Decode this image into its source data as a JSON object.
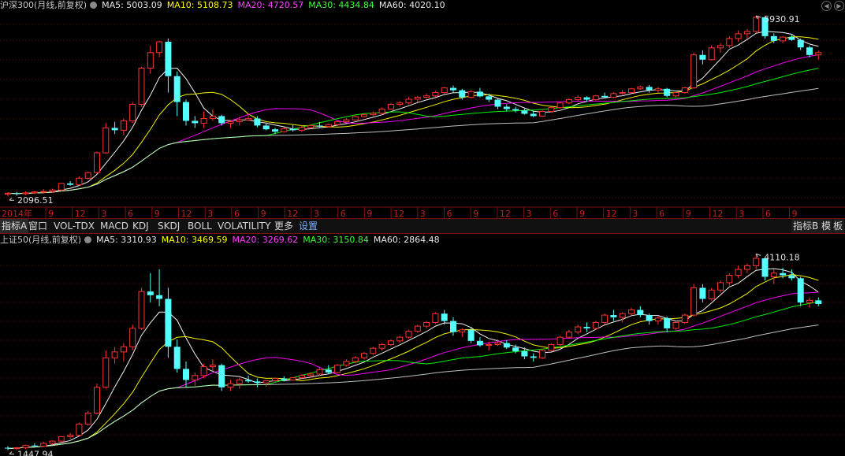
{
  "panels": [
    {
      "name": "沪深300(月线,前复权)",
      "ma": [
        {
          "label": "MA5: 5003.09",
          "color": "#ffffff"
        },
        {
          "label": "MA10: 5108.73",
          "color": "#ffff00"
        },
        {
          "label": "MA20: 4720.57",
          "color": "#ff00ff"
        },
        {
          "label": "MA30: 4434.84",
          "color": "#00ff00"
        },
        {
          "label": "MA60: 4020.10",
          "color": "#ffffff"
        }
      ],
      "high_label": "5930.91",
      "low_label": "2096.51"
    },
    {
      "name": "上证50(月线,前复权)",
      "ma": [
        {
          "label": "MA5: 3310.93",
          "color": "#ffffff"
        },
        {
          "label": "MA10: 3469.59",
          "color": "#ffff00"
        },
        {
          "label": "MA20: 3269.62",
          "color": "#ff00ff"
        },
        {
          "label": "MA30: 3150.84",
          "color": "#00ff00"
        },
        {
          "label": "MA60: 2864.48",
          "color": "#ffffff"
        }
      ],
      "high_label": "4110.18",
      "low_label": "1447.94"
    }
  ],
  "time_axis": {
    "labels": [
      "2014年",
      "9",
      "12",
      "3",
      "6",
      "9",
      "12",
      "3",
      "6",
      "9",
      "12",
      "3",
      "6",
      "9",
      "12",
      "3",
      "6",
      "9",
      "12",
      "3",
      "6",
      "9",
      "12",
      "3",
      "6",
      "9",
      "12",
      "3",
      "6",
      "9"
    ]
  },
  "toolbar": {
    "tabs": [
      "指标A",
      "窗口",
      "VOL-TDX",
      "MACD",
      "KDJ",
      "SKDJ",
      "BOLL",
      "VOLATILITY",
      "更多",
      "设置"
    ],
    "right_tabs": [
      "指标B",
      "模",
      "板"
    ]
  },
  "chart_data": [
    {
      "type": "candlestick",
      "title": "沪深300(月线,前复权)",
      "x_start": "2014-01",
      "period": "monthly",
      "ylim": [
        2000,
        6000
      ],
      "ohlc": [
        [
          2140,
          2180,
          2096.51,
          2160
        ],
        [
          2160,
          2190,
          2110,
          2150
        ],
        [
          2150,
          2200,
          2120,
          2170
        ],
        [
          2170,
          2210,
          2140,
          2190
        ],
        [
          2190,
          2250,
          2160,
          2200
        ],
        [
          2200,
          2260,
          2170,
          2230
        ],
        [
          2230,
          2380,
          2200,
          2370
        ],
        [
          2370,
          2420,
          2320,
          2340
        ],
        [
          2340,
          2520,
          2330,
          2480
        ],
        [
          2480,
          2620,
          2450,
          2600
        ],
        [
          2600,
          3050,
          2580,
          3020
        ],
        [
          3020,
          3650,
          3000,
          3550
        ],
        [
          3550,
          3680,
          3420,
          3500
        ],
        [
          3500,
          3750,
          3400,
          3700
        ],
        [
          3700,
          4100,
          3650,
          4050
        ],
        [
          4050,
          4850,
          4000,
          4820
        ],
        [
          4820,
          5300,
          4700,
          5150
        ],
        [
          5150,
          5400,
          5050,
          5380
        ],
        [
          5380,
          5450,
          4300,
          4650
        ],
        [
          4650,
          4750,
          3800,
          4100
        ],
        [
          4100,
          4150,
          3600,
          3700
        ],
        [
          3700,
          3800,
          3550,
          3650
        ],
        [
          3650,
          3900,
          3550,
          3750
        ],
        [
          3750,
          3950,
          3700,
          3800
        ],
        [
          3800,
          3830,
          3600,
          3650
        ],
        [
          3650,
          3700,
          3550,
          3680
        ],
        [
          3680,
          3780,
          3600,
          3720
        ],
        [
          3720,
          3820,
          3700,
          3750
        ],
        [
          3750,
          3800,
          3560,
          3600
        ],
        [
          3600,
          3640,
          3500,
          3520
        ],
        [
          3520,
          3550,
          3420,
          3470
        ],
        [
          3470,
          3560,
          3450,
          3530
        ],
        [
          3530,
          3610,
          3470,
          3500
        ],
        [
          3500,
          3600,
          3460,
          3560
        ],
        [
          3560,
          3620,
          3540,
          3600
        ],
        [
          3600,
          3680,
          3550,
          3580
        ],
        [
          3580,
          3640,
          3560,
          3620
        ],
        [
          3620,
          3700,
          3590,
          3680
        ],
        [
          3680,
          3760,
          3650,
          3720
        ],
        [
          3720,
          3810,
          3700,
          3790
        ],
        [
          3790,
          3850,
          3770,
          3830
        ],
        [
          3830,
          3900,
          3800,
          3860
        ],
        [
          3860,
          3980,
          3840,
          3950
        ],
        [
          3950,
          4080,
          3930,
          4050
        ],
        [
          4050,
          4120,
          4000,
          4080
        ],
        [
          4080,
          4200,
          4050,
          4160
        ],
        [
          4160,
          4230,
          4100,
          4200
        ],
        [
          4200,
          4280,
          4180,
          4230
        ],
        [
          4230,
          4340,
          4200,
          4300
        ],
        [
          4300,
          4420,
          4280,
          4400
        ],
        [
          4400,
          4450,
          4300,
          4350
        ],
        [
          4350,
          4380,
          4150,
          4200
        ],
        [
          4200,
          4350,
          4180,
          4320
        ],
        [
          4320,
          4400,
          4200,
          4220
        ],
        [
          4220,
          4280,
          4100,
          4150
        ],
        [
          4150,
          4180,
          3950,
          4000
        ],
        [
          4000,
          4050,
          3900,
          3950
        ],
        [
          3950,
          4000,
          3880,
          3920
        ],
        [
          3920,
          3960,
          3830,
          3850
        ],
        [
          3850,
          3900,
          3780,
          3800
        ],
        [
          3800,
          3950,
          3780,
          3900
        ],
        [
          3900,
          4000,
          3880,
          3980
        ],
        [
          3980,
          4100,
          3960,
          4080
        ],
        [
          4080,
          4180,
          4050,
          4150
        ],
        [
          4150,
          4250,
          4120,
          4200
        ],
        [
          4200,
          4220,
          4100,
          4150
        ],
        [
          4150,
          4250,
          4130,
          4230
        ],
        [
          4230,
          4300,
          4180,
          4200
        ],
        [
          4200,
          4310,
          4180,
          4280
        ],
        [
          4280,
          4360,
          4260,
          4300
        ],
        [
          4300,
          4400,
          4280,
          4380
        ],
        [
          4380,
          4450,
          4360,
          4420
        ],
        [
          4420,
          4460,
          4300,
          4350
        ],
        [
          4350,
          4420,
          4300,
          4380
        ],
        [
          4380,
          4400,
          4200,
          4230
        ],
        [
          4230,
          4310,
          4200,
          4300
        ],
        [
          4300,
          4420,
          4280,
          4400
        ],
        [
          4400,
          5150,
          4380,
          5100
        ],
        [
          5100,
          5200,
          4900,
          5000
        ],
        [
          5000,
          5300,
          4980,
          5250
        ],
        [
          5250,
          5350,
          5150,
          5300
        ],
        [
          5300,
          5500,
          5250,
          5450
        ],
        [
          5450,
          5620,
          5380,
          5550
        ],
        [
          5550,
          5650,
          5450,
          5600
        ],
        [
          5600,
          5930.91,
          5560,
          5900
        ],
        [
          5900,
          5910,
          5450,
          5500
        ],
        [
          5500,
          5560,
          5350,
          5400
        ],
        [
          5400,
          5500,
          5350,
          5480
        ],
        [
          5480,
          5520,
          5400,
          5420
        ],
        [
          5420,
          5450,
          5200,
          5260
        ],
        [
          5260,
          5300,
          5050,
          5100
        ],
        [
          5100,
          5190,
          5000,
          5150
        ]
      ]
    },
    {
      "type": "candlestick",
      "title": "上证50(月线,前复权)",
      "x_start": "2014-01",
      "period": "monthly",
      "ylim": [
        1400,
        4200
      ],
      "ohlc": [
        [
          1480,
          1500,
          1447.94,
          1470
        ],
        [
          1470,
          1490,
          1450,
          1480
        ],
        [
          1480,
          1520,
          1460,
          1510
        ],
        [
          1510,
          1540,
          1490,
          1500
        ],
        [
          1500,
          1560,
          1490,
          1540
        ],
        [
          1540,
          1580,
          1520,
          1570
        ],
        [
          1570,
          1640,
          1550,
          1630
        ],
        [
          1630,
          1680,
          1600,
          1650
        ],
        [
          1650,
          1820,
          1640,
          1800
        ],
        [
          1800,
          1980,
          1780,
          1950
        ],
        [
          1950,
          2350,
          1930,
          2300
        ],
        [
          2300,
          2800,
          2280,
          2700
        ],
        [
          2700,
          2850,
          2620,
          2780
        ],
        [
          2780,
          2900,
          2650,
          2850
        ],
        [
          2850,
          3150,
          2800,
          3100
        ],
        [
          3100,
          3650,
          3080,
          3600
        ],
        [
          3600,
          3850,
          3450,
          3550
        ],
        [
          3550,
          3900,
          3400,
          3500
        ],
        [
          3500,
          3650,
          2700,
          2850
        ],
        [
          2850,
          2950,
          2500,
          2550
        ],
        [
          2550,
          2650,
          2300,
          2400
        ],
        [
          2400,
          2500,
          2320,
          2460
        ],
        [
          2460,
          2620,
          2420,
          2580
        ],
        [
          2580,
          2680,
          2520,
          2600
        ],
        [
          2600,
          2620,
          2250,
          2300
        ],
        [
          2300,
          2400,
          2250,
          2350
        ],
        [
          2350,
          2430,
          2280,
          2400
        ],
        [
          2400,
          2460,
          2360,
          2380
        ],
        [
          2380,
          2420,
          2300,
          2360
        ],
        [
          2360,
          2400,
          2310,
          2390
        ],
        [
          2390,
          2430,
          2370,
          2420
        ],
        [
          2420,
          2450,
          2380,
          2400
        ],
        [
          2400,
          2440,
          2390,
          2430
        ],
        [
          2430,
          2480,
          2410,
          2460
        ],
        [
          2460,
          2500,
          2440,
          2480
        ],
        [
          2480,
          2560,
          2460,
          2540
        ],
        [
          2540,
          2600,
          2480,
          2500
        ],
        [
          2500,
          2620,
          2490,
          2600
        ],
        [
          2600,
          2680,
          2580,
          2650
        ],
        [
          2650,
          2720,
          2630,
          2700
        ],
        [
          2700,
          2780,
          2680,
          2760
        ],
        [
          2760,
          2850,
          2740,
          2830
        ],
        [
          2830,
          2900,
          2800,
          2880
        ],
        [
          2880,
          2950,
          2860,
          2930
        ],
        [
          2930,
          3000,
          2900,
          2980
        ],
        [
          2980,
          3080,
          2960,
          3060
        ],
        [
          3060,
          3150,
          3040,
          3130
        ],
        [
          3130,
          3200,
          3100,
          3180
        ],
        [
          3180,
          3320,
          3160,
          3300
        ],
        [
          3300,
          3350,
          3150,
          3200
        ],
        [
          3200,
          3250,
          3000,
          3050
        ],
        [
          3050,
          3100,
          2980,
          3080
        ],
        [
          3080,
          3120,
          2900,
          2930
        ],
        [
          2930,
          2980,
          2850,
          2870
        ],
        [
          2870,
          2920,
          2800,
          2880
        ],
        [
          2880,
          2950,
          2860,
          2900
        ],
        [
          2900,
          2940,
          2820,
          2840
        ],
        [
          2840,
          2880,
          2760,
          2790
        ],
        [
          2790,
          2840,
          2680,
          2720
        ],
        [
          2720,
          2760,
          2650,
          2700
        ],
        [
          2700,
          2820,
          2680,
          2800
        ],
        [
          2800,
          2900,
          2780,
          2880
        ],
        [
          2880,
          3000,
          2860,
          2980
        ],
        [
          2980,
          3080,
          2960,
          3050
        ],
        [
          3050,
          3150,
          3020,
          3120
        ],
        [
          3120,
          3180,
          3050,
          3100
        ],
        [
          3100,
          3200,
          3080,
          3180
        ],
        [
          3180,
          3300,
          3150,
          3280
        ],
        [
          3280,
          3350,
          3200,
          3250
        ],
        [
          3250,
          3320,
          3180,
          3300
        ],
        [
          3300,
          3380,
          3280,
          3350
        ],
        [
          3350,
          3400,
          3250,
          3280
        ],
        [
          3280,
          3300,
          3150,
          3200
        ],
        [
          3200,
          3260,
          3150,
          3240
        ],
        [
          3240,
          3260,
          3050,
          3100
        ],
        [
          3100,
          3200,
          3080,
          3180
        ],
        [
          3180,
          3300,
          3160,
          3280
        ],
        [
          3280,
          3700,
          3260,
          3650
        ],
        [
          3650,
          3700,
          3450,
          3500
        ],
        [
          3500,
          3650,
          3480,
          3620
        ],
        [
          3620,
          3750,
          3580,
          3720
        ],
        [
          3720,
          3850,
          3680,
          3820
        ],
        [
          3820,
          3950,
          3780,
          3900
        ],
        [
          3900,
          3980,
          3850,
          3950
        ],
        [
          3950,
          4110.18,
          3900,
          4050
        ],
        [
          4050,
          4060,
          3750,
          3800
        ],
        [
          3800,
          3900,
          3700,
          3850
        ],
        [
          3850,
          3920,
          3780,
          3820
        ],
        [
          3820,
          3900,
          3750,
          3780
        ],
        [
          3780,
          3800,
          3400,
          3450
        ],
        [
          3450,
          3520,
          3380,
          3480
        ],
        [
          3480,
          3520,
          3400,
          3430
        ]
      ]
    }
  ]
}
